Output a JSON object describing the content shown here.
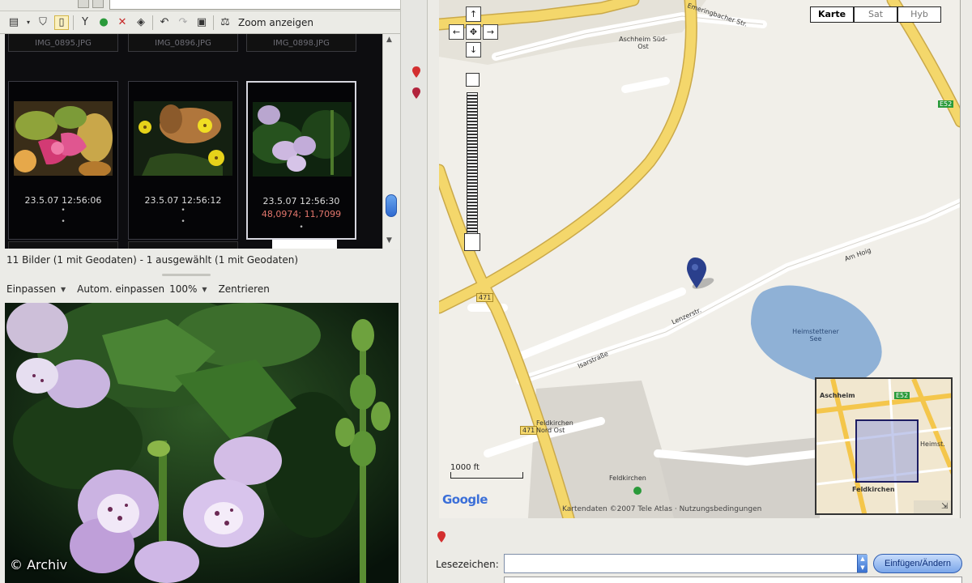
{
  "left_pane": {
    "zoom_label": "Zoom anzeigen",
    "thumbnails_top": [
      "IMG_0895.JPG",
      "IMG_0896.JPG",
      "IMG_0898.JPG"
    ],
    "thumbnails": [
      {
        "date": "23.5.07 12:56:06",
        "coords": ""
      },
      {
        "date": "23.5.07 12:56:12",
        "coords": ""
      },
      {
        "date": "23.5.07 12:56:30",
        "coords": "48,0974; 11,7099"
      }
    ],
    "status": "11 Bilder (1 mit Geodaten) - 1 ausgewählt (1 mit Geodaten)",
    "viewer_toolbar": {
      "fit": "Einpassen",
      "auto_fit": "Autom. einpassen",
      "zoom_percent": "100%",
      "center": "Zentrieren"
    },
    "credit": "© Archiv"
  },
  "map": {
    "types": [
      {
        "label": "Karte",
        "active": true
      },
      {
        "label": "Sat",
        "active": false
      },
      {
        "label": "Hyb",
        "active": false
      }
    ],
    "labels": {
      "area1": "Aschheim Süd-Ost",
      "lake": "Heimstettener See",
      "road1": "Emeringbacher Str.",
      "road2": "Lenzerstr.",
      "road3": "Isarstraße",
      "road4": "Am Hoig",
      "district": "Feldkirchen Nord Ost",
      "area2": "Feldkirchen",
      "route_471": "471",
      "route_471b": "471",
      "a99": "E52",
      "e52": "E52"
    },
    "scale": "1000 ft",
    "google_logo": "Google",
    "copyright": "Kartendaten ©2007 Tele Atlas · Nutzungsbedingungen",
    "overview_labels": {
      "top_left": "Aschheim",
      "top_right": "E52",
      "right": "Heimst.",
      "bottom": "Feldkirchen"
    }
  },
  "location_form": {
    "label": "Lesezeichen:",
    "value": "",
    "apply_button": "Einfügen/Ändern"
  },
  "colors": {
    "road": "#f4d76b",
    "water": "#8fb1d6",
    "map_bg": "#f1efe9",
    "pin": "#2a3f8c",
    "accent": "#3870cf"
  }
}
